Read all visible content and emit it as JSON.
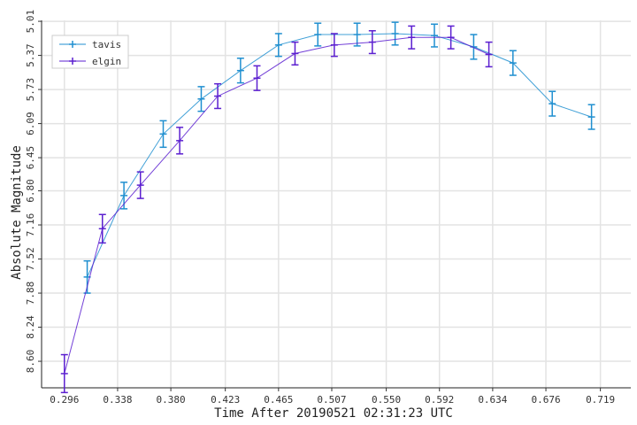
{
  "chart_data": {
    "type": "line",
    "xlabel": "Time After 20190521 02:31:23 UTC",
    "ylabel": "Absolute Magnitude",
    "x_ticks": [
      "0.296",
      "0.338",
      "0.380",
      "0.423",
      "0.465",
      "0.507",
      "0.550",
      "0.592",
      "0.634",
      "0.676",
      "0.719"
    ],
    "y_ticks": [
      "5.01",
      "5.37",
      "5.73",
      "6.09",
      "6.45",
      "6.80",
      "7.16",
      "7.52",
      "7.88",
      "8.24",
      "8.60"
    ],
    "xlim": [
      0.278,
      0.743
    ],
    "ylim": [
      5.0,
      8.88
    ],
    "y_inverted": true,
    "grid": true,
    "legend_position": "top-left",
    "series": [
      {
        "name": "tavis",
        "color": "#1f8fd0",
        "x": [
          0.314,
          0.343,
          0.374,
          0.404,
          0.435,
          0.465,
          0.496,
          0.527,
          0.557,
          0.588,
          0.619,
          0.65,
          0.681,
          0.712
        ],
        "y": [
          7.71,
          6.85,
          6.2,
          5.83,
          5.53,
          5.26,
          5.15,
          5.15,
          5.14,
          5.16,
          5.28,
          5.45,
          5.88,
          6.02
        ],
        "err": [
          0.17,
          0.14,
          0.14,
          0.13,
          0.13,
          0.12,
          0.12,
          0.12,
          0.12,
          0.12,
          0.13,
          0.13,
          0.13,
          0.13
        ]
      },
      {
        "name": "elgin",
        "color": "#5b1fd0",
        "x": [
          0.296,
          0.326,
          0.356,
          0.387,
          0.417,
          0.448,
          0.478,
          0.509,
          0.539,
          0.57,
          0.601,
          0.631
        ],
        "y": [
          8.73,
          7.2,
          6.74,
          6.27,
          5.8,
          5.61,
          5.35,
          5.26,
          5.23,
          5.18,
          5.18,
          5.36
        ],
        "err": [
          0.2,
          0.15,
          0.14,
          0.14,
          0.13,
          0.13,
          0.12,
          0.12,
          0.12,
          0.12,
          0.12,
          0.13
        ]
      }
    ]
  }
}
